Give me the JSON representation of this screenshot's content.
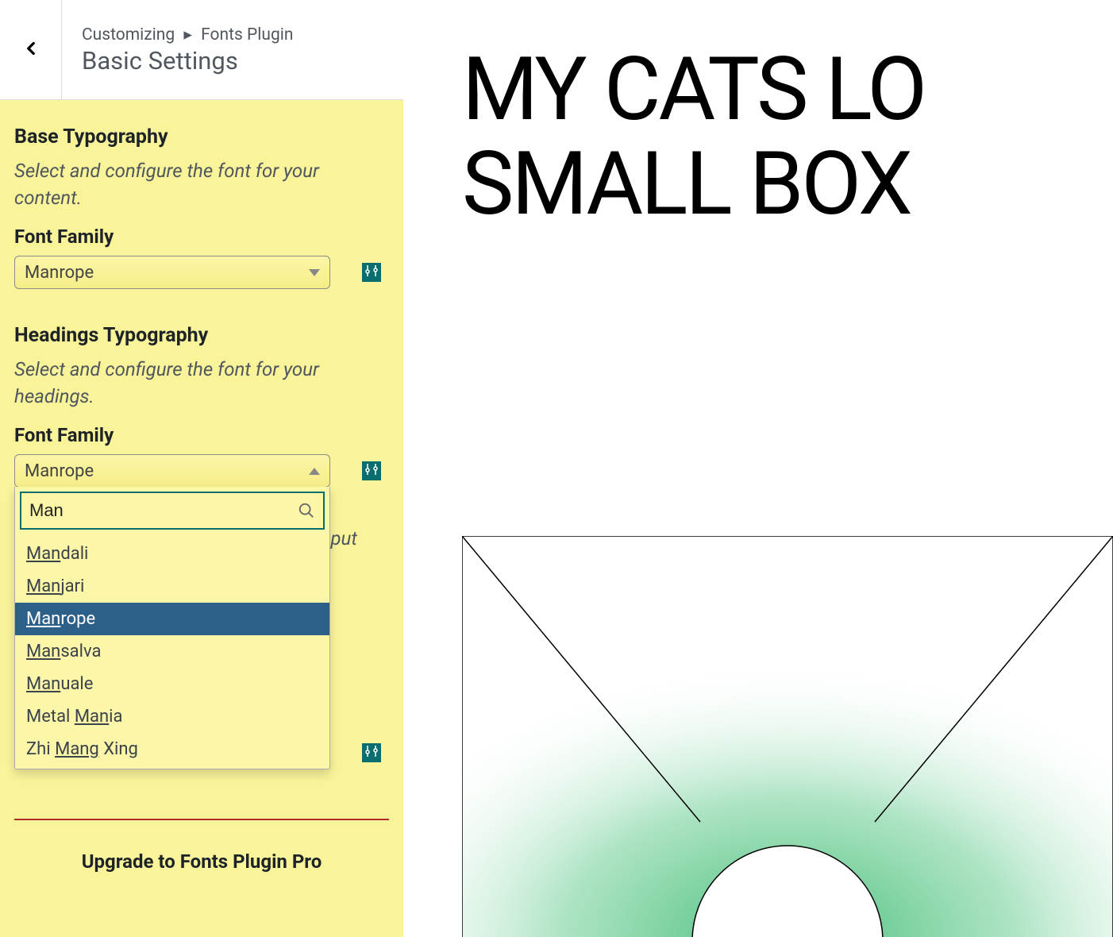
{
  "header": {
    "breadcrumb_prefix": "Customizing",
    "breadcrumb_plugin": "Fonts Plugin",
    "title": "Basic Settings"
  },
  "sections": {
    "base": {
      "heading": "Base Typography",
      "desc": "Select and configure the font for your content.",
      "field_label": "Font Family",
      "selected": "Manrope"
    },
    "headings": {
      "heading": "Headings Typography",
      "desc": "Select and configure the font for your headings.",
      "field_label": "Font Family",
      "selected": "Manrope"
    },
    "search": {
      "value": "Man"
    },
    "options": [
      {
        "match": "Man",
        "rest": "dali",
        "selected": false
      },
      {
        "match": "Man",
        "rest": "jari",
        "selected": false
      },
      {
        "match": "Man",
        "rest": "rope",
        "selected": true
      },
      {
        "match": "Man",
        "rest": "salva",
        "selected": false
      },
      {
        "match": "Man",
        "rest": "uale",
        "selected": false
      },
      {
        "pre": "Metal ",
        "match": "Man",
        "rest": "ia",
        "selected": false
      },
      {
        "pre": "Zhi ",
        "match": "Mang",
        "rest": " Xing",
        "selected": false
      }
    ],
    "hidden_desc_tail": "nput"
  },
  "upgrade": {
    "label": "Upgrade to Fonts Plugin Pro"
  },
  "preview": {
    "line1": "MY CATS LO",
    "line2": "SMALL BOX"
  },
  "colors": {
    "accent": "#0a6e6e",
    "panel_bg": "#f9f39a",
    "selected_bg": "#2c6089",
    "upgrade_border": "#b02b2b"
  }
}
